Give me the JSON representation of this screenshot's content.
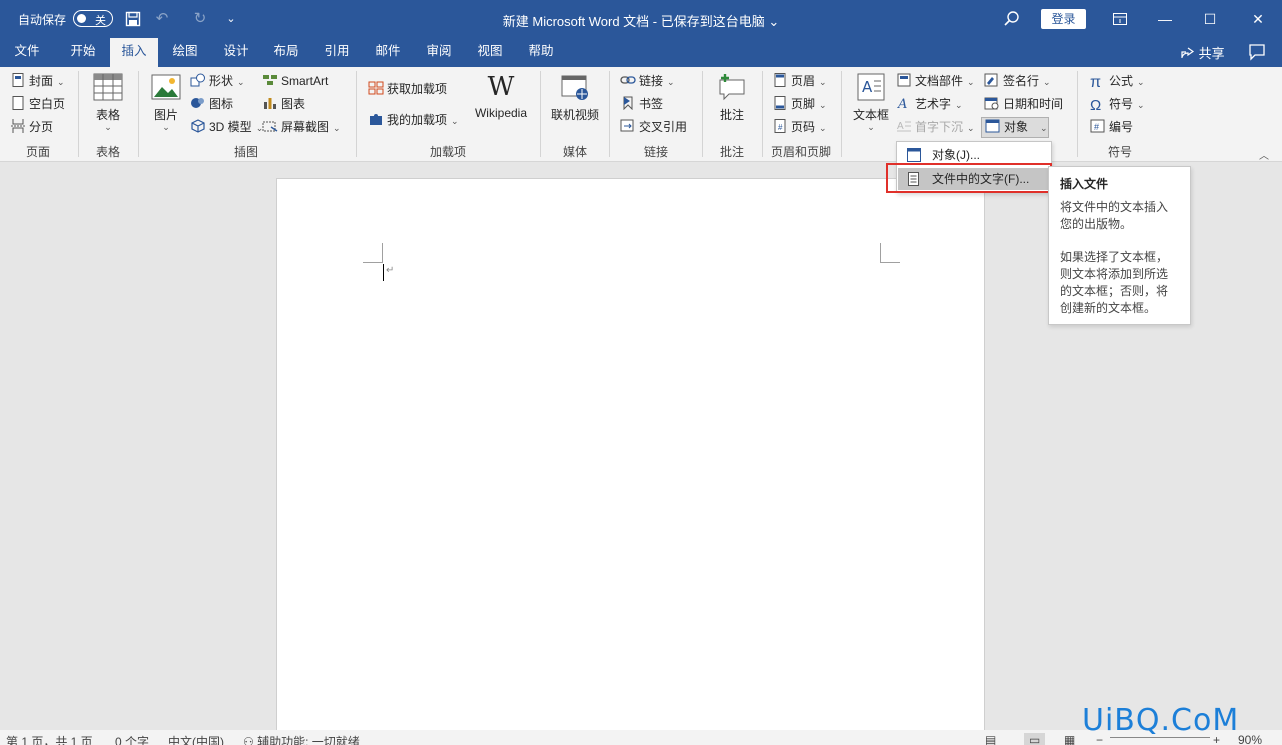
{
  "titlebar": {
    "autosave_label": "自动保存",
    "autosave_state": "关",
    "title": "新建 Microsoft Word 文档 - 已保存到这台电脑 ⌄",
    "login": "登录",
    "icons": [
      "save-icon",
      "undo-icon",
      "redo-icon",
      "customize-qat-icon",
      "search-icon",
      "ribbon-display-icon",
      "minimize-icon",
      "maximize-icon",
      "close-icon"
    ]
  },
  "tabs": [
    "文件",
    "开始",
    "插入",
    "绘图",
    "设计",
    "布局",
    "引用",
    "邮件",
    "审阅",
    "视图",
    "帮助"
  ],
  "active_tab": "插入",
  "share_label": "共享",
  "ribbon": {
    "pages": {
      "label": "页面",
      "items": [
        "封面",
        "空白页",
        "分页"
      ]
    },
    "tables": {
      "label": "表格",
      "button": "表格"
    },
    "illustrations": {
      "label": "插图",
      "picture": "图片",
      "shapes": "形状",
      "icons": "图标",
      "model3d": "3D 模型",
      "smartart": "SmartArt",
      "chart": "图表",
      "screenshot": "屏幕截图"
    },
    "addins": {
      "label": "加载项",
      "get": "获取加载项",
      "my": "我的加载项",
      "wikipedia": "Wikipedia"
    },
    "media": {
      "label": "媒体",
      "video": "联机视频"
    },
    "links": {
      "label": "链接",
      "link": "链接",
      "bookmark": "书签",
      "crossref": "交叉引用"
    },
    "comments": {
      "label": "批注",
      "comment": "批注"
    },
    "header_footer": {
      "label": "页眉和页脚",
      "header": "页眉",
      "footer": "页脚",
      "page_number": "页码"
    },
    "text": {
      "textbox": "文本框",
      "quickparts": "文档部件",
      "wordart": "艺术字",
      "dropcap": "首字下沉",
      "signature": "签名行",
      "datetime": "日期和时间",
      "object": "对象"
    },
    "symbols": {
      "label": "符号",
      "equation": "公式",
      "symbol": "符号",
      "number": "编号"
    }
  },
  "object_menu": {
    "items": [
      "对象(J)...",
      "文件中的文字(F)..."
    ]
  },
  "tooltip": {
    "title": "插入文件",
    "para1": "将文件中的文本插入您的出版物。",
    "para2": "如果选择了文本框，则文本将添加到所选的文本框；否则，将创建新的文本框。"
  },
  "status": {
    "page": "第 1 页，共 1 页",
    "words": "0 个字",
    "language": "中文(中国)",
    "accessibility": "辅助功能: 一切就绪",
    "zoom": "90%"
  },
  "watermark": "UiBQ.CoM",
  "colors": {
    "accent": "#2b579a",
    "highlight": "#e0302a"
  }
}
